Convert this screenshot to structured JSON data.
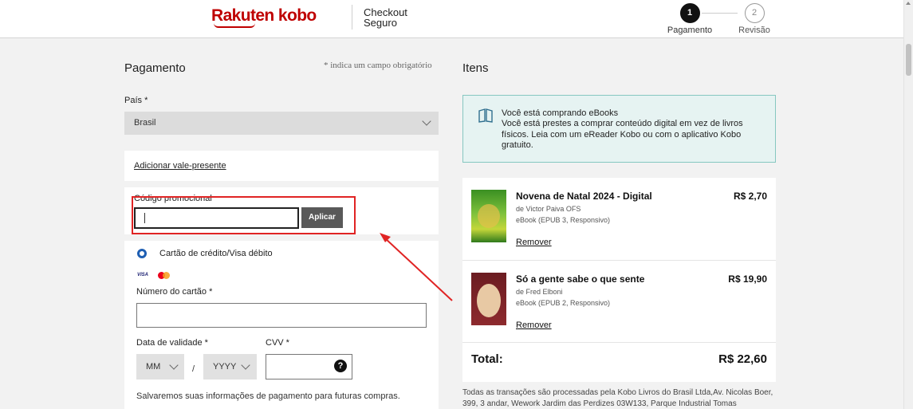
{
  "header": {
    "logo": "Rakuten kobo",
    "checkout_line1": "Checkout",
    "checkout_line2": "Seguro",
    "steps": [
      {
        "number": "1",
        "label": "Pagamento"
      },
      {
        "number": "2",
        "label": "Revisão"
      }
    ]
  },
  "payment": {
    "title": "Pagamento",
    "required_note": "* indica um campo obrigatório",
    "country_label": "País *",
    "country_value": "Brasil",
    "gift_card_link": "Adicionar vale-presente",
    "promo_label": "Código promocional",
    "promo_value": "",
    "apply_button": "Aplicar",
    "method_label": "Cartão de crédito/Visa débito",
    "card_brands": [
      "VISA",
      "mastercard"
    ],
    "card_number_label": "Número do cartão *",
    "expiry_label": "Data de validade *",
    "month_placeholder": "MM",
    "year_placeholder": "YYYY",
    "separator": "/",
    "cvv_label": "CVV *",
    "help_icon": "?",
    "save_note": "Salvaremos suas informações de pagamento para futuras compras."
  },
  "items": {
    "title": "Itens",
    "notice_title": "Você está comprando eBooks",
    "notice_text": "Você está prestes a comprar conteúdo digital em vez de livros físicos. Leia com um eReader Kobo ou com o aplicativo Kobo gratuito.",
    "list": [
      {
        "title": "Novena de Natal 2024 - Digital",
        "author": "de Victor Paiva OFS",
        "format": "eBook (EPUB 3, Responsivo)",
        "price": "R$ 2,70",
        "remove": "Remover"
      },
      {
        "title": "Só a gente sabe o que sente",
        "author": "de Fred Elboni",
        "format": "eBook (EPUB 2, Responsivo)",
        "price": "R$ 19,90",
        "remove": "Remover"
      }
    ],
    "total_label": "Total:",
    "total_value": "R$ 22,60",
    "footer": "Todas as transações são processadas pela Kobo Livros do Brasil Ltda,Av. Nicolas Boer, 399, 3 andar, Wework Jardim das Perdizes 03W133, Parque Industrial Tomas"
  },
  "colors": {
    "brand": "#bf0000",
    "annotation": "#e02424",
    "notice_bg": "#e6f3f2"
  }
}
